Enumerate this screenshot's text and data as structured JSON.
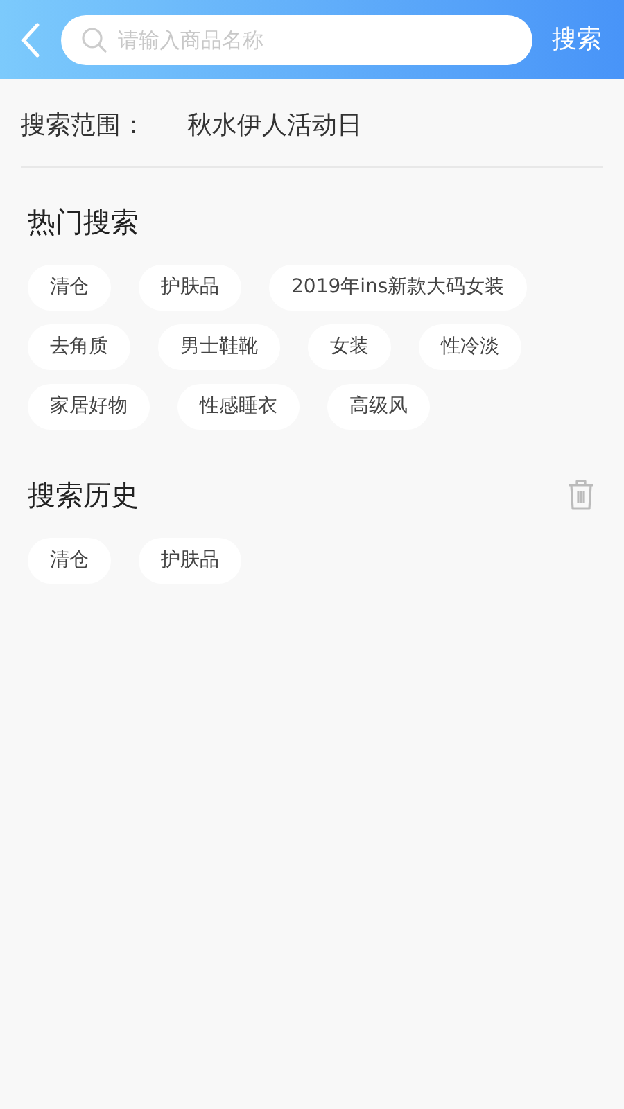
{
  "header": {
    "search_placeholder": "请输入商品名称",
    "search_button": "搜索"
  },
  "scope": {
    "label": "搜索范围：",
    "value": "秋水伊人活动日"
  },
  "hot_search": {
    "title": "热门搜索",
    "tags": [
      "清仓",
      "护肤品",
      "2019年ins新款大码女装",
      "去角质",
      "男士鞋靴",
      "女装",
      "性冷淡",
      "家居好物",
      "性感睡衣",
      "高级风"
    ]
  },
  "history": {
    "title": "搜索历史",
    "tags": [
      "清仓",
      "护肤品"
    ]
  }
}
